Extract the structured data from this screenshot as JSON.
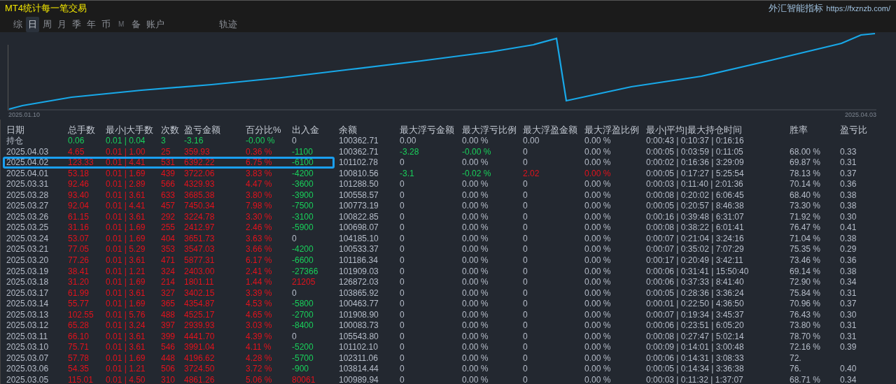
{
  "window": {
    "title": "MT4统计每一笔交易",
    "brand": "外汇智能指标",
    "url": "https://fxznzb.com/"
  },
  "tabs": [
    {
      "label": "综",
      "selected": false,
      "kind": "normal"
    },
    {
      "label": "日",
      "selected": true,
      "kind": "normal"
    },
    {
      "label": "周",
      "selected": false,
      "kind": "normal"
    },
    {
      "label": "月",
      "selected": false,
      "kind": "normal"
    },
    {
      "label": "季",
      "selected": false,
      "kind": "normal"
    },
    {
      "label": "年",
      "selected": false,
      "kind": "normal"
    },
    {
      "label": "币",
      "selected": false,
      "kind": "normal"
    },
    {
      "label": "M",
      "selected": false,
      "kind": "small"
    },
    {
      "label": "备",
      "selected": false,
      "kind": "normal"
    },
    {
      "label": "账户",
      "selected": false,
      "kind": "normal"
    },
    {
      "label": "轨迹",
      "selected": false,
      "kind": "far"
    }
  ],
  "chart": {
    "start_label": "2025.01.10",
    "end_label": "2025.04.03"
  },
  "table": {
    "columns": [
      "日期",
      "总手数",
      "最小|大手数",
      "次数",
      "盈亏金额",
      "百分比%",
      "出入金",
      "余额",
      "最大浮亏金额",
      "最大浮亏比例",
      "最大浮盈金额",
      "最大浮盈比例",
      "最小|平均|最大持仓时间",
      "胜率",
      "盈亏比"
    ],
    "rows": [
      {
        "selected": false,
        "cells": [
          "持仓",
          {
            "text": "0.06",
            "color": "#19cf5a"
          },
          {
            "text": "0.01 | 0.04",
            "color": "#19cf5a"
          },
          {
            "text": "3",
            "color": "#19cf5a"
          },
          {
            "text": "-3.16",
            "color": "#19cf5a"
          },
          {
            "text": "-0.00 %",
            "color": "#19cf5a"
          },
          "0",
          "100362.71",
          "0.00",
          "0.00 %",
          "0.00",
          "0.00 %",
          "0:00:43 | 0:10:37 | 0:16:16"
        ]
      },
      {
        "selected": false,
        "cells": [
          "2025.04.03",
          {
            "text": "4.65",
            "color": "#e3121c"
          },
          {
            "text": "0.01 | 1.00",
            "color": "#e3121c"
          },
          {
            "text": "25",
            "color": "#e3121c"
          },
          {
            "text": "359.93",
            "color": "#e3121c"
          },
          {
            "text": "0.36 %",
            "color": "#e3121c"
          },
          {
            "text": "-1100",
            "color": "#19cf5a"
          },
          "100362.71",
          {
            "text": "-3.28",
            "color": "#19cf5a"
          },
          {
            "text": "-0.00 %",
            "color": "#19cf5a"
          },
          "0",
          "0.00 %",
          "0:00:05 | 0:03:59 | 0:11:05",
          "68.00 %",
          "0.33"
        ]
      },
      {
        "selected": true,
        "cells": [
          "2025.04.02",
          {
            "text": "123.33",
            "color": "#e3121c"
          },
          {
            "text": "0.01 | 4.41",
            "color": "#e3121c"
          },
          {
            "text": "531",
            "color": "#e3121c"
          },
          {
            "text": "6392.22",
            "color": "#e3121c"
          },
          {
            "text": "6.75 %",
            "color": "#e3121c"
          },
          {
            "text": "-6100",
            "color": "#19cf5a"
          },
          "101102.78",
          "0",
          "0.00 %",
          "0",
          "0.00 %",
          "0:00:02 | 0:16:36 | 3:29:09",
          "69.87 %",
          "0.31"
        ]
      },
      {
        "selected": false,
        "cells": [
          "2025.04.01",
          {
            "text": "53.18",
            "color": "#e3121c"
          },
          {
            "text": "0.01 | 1.69",
            "color": "#e3121c"
          },
          {
            "text": "439",
            "color": "#e3121c"
          },
          {
            "text": "3722.06",
            "color": "#e3121c"
          },
          {
            "text": "3.83 %",
            "color": "#e3121c"
          },
          {
            "text": "-4200",
            "color": "#19cf5a"
          },
          "100810.56",
          {
            "text": "-3.1",
            "color": "#19cf5a"
          },
          {
            "text": "-0.02 %",
            "color": "#19cf5a"
          },
          {
            "text": "2.02",
            "color": "#e3121c"
          },
          {
            "text": "0.00 %",
            "color": "#e3121c"
          },
          "0:00:05 | 0:17:27 | 5:25:54",
          "78.13 %",
          "0.37"
        ]
      },
      {
        "selected": false,
        "cells": [
          "2025.03.31",
          {
            "text": "92.46",
            "color": "#e3121c"
          },
          {
            "text": "0.01 | 2.89",
            "color": "#e3121c"
          },
          {
            "text": "566",
            "color": "#e3121c"
          },
          {
            "text": "4329.93",
            "color": "#e3121c"
          },
          {
            "text": "4.47 %",
            "color": "#e3121c"
          },
          {
            "text": "-3600",
            "color": "#19cf5a"
          },
          "101288.50",
          "0",
          "0.00 %",
          "0",
          "0.00 %",
          "0:00:03 | 0:11:40 | 2:01:36",
          "70.14 %",
          "0.36"
        ]
      },
      {
        "selected": false,
        "cells": [
          "2025.03.28",
          {
            "text": "93.40",
            "color": "#e3121c"
          },
          {
            "text": "0.01 | 3.61",
            "color": "#e3121c"
          },
          {
            "text": "633",
            "color": "#e3121c"
          },
          {
            "text": "3685.38",
            "color": "#e3121c"
          },
          {
            "text": "3.80 %",
            "color": "#e3121c"
          },
          {
            "text": "-3900",
            "color": "#19cf5a"
          },
          "100558.57",
          "0",
          "0.00 %",
          "0",
          "0.00 %",
          "0:00:08 | 0:20:02 | 6:06:45",
          "68.40 %",
          "0.38"
        ]
      },
      {
        "selected": false,
        "cells": [
          "2025.03.27",
          {
            "text": "92.04",
            "color": "#e3121c"
          },
          {
            "text": "0.01 | 4.41",
            "color": "#e3121c"
          },
          {
            "text": "457",
            "color": "#e3121c"
          },
          {
            "text": "7450.34",
            "color": "#e3121c"
          },
          {
            "text": "7.98 %",
            "color": "#e3121c"
          },
          {
            "text": "-7500",
            "color": "#19cf5a"
          },
          "100773.19",
          "0",
          "0.00 %",
          "0",
          "0.00 %",
          "0:00:05 | 0:20:57 | 8:46:38",
          "73.30 %",
          "0.38"
        ]
      },
      {
        "selected": false,
        "cells": [
          "2025.03.26",
          {
            "text": "61.15",
            "color": "#e3121c"
          },
          {
            "text": "0.01 | 3.61",
            "color": "#e3121c"
          },
          {
            "text": "292",
            "color": "#e3121c"
          },
          {
            "text": "3224.78",
            "color": "#e3121c"
          },
          {
            "text": "3.30 %",
            "color": "#e3121c"
          },
          {
            "text": "-3100",
            "color": "#19cf5a"
          },
          "100822.85",
          "0",
          "0.00 %",
          "0",
          "0.00 %",
          "0:00:16 | 0:39:48 | 6:31:07",
          "71.92 %",
          "0.30"
        ]
      },
      {
        "selected": false,
        "cells": [
          "2025.03.25",
          {
            "text": "31.16",
            "color": "#e3121c"
          },
          {
            "text": "0.01 | 1.69",
            "color": "#e3121c"
          },
          {
            "text": "255",
            "color": "#e3121c"
          },
          {
            "text": "2412.97",
            "color": "#e3121c"
          },
          {
            "text": "2.46 %",
            "color": "#e3121c"
          },
          {
            "text": "-5900",
            "color": "#19cf5a"
          },
          "100698.07",
          "0",
          "0.00 %",
          "0",
          "0.00 %",
          "0:00:08 | 0:38:22 | 6:01:41",
          "76.47 %",
          "0.41"
        ]
      },
      {
        "selected": false,
        "cells": [
          "2025.03.24",
          {
            "text": "53.07",
            "color": "#e3121c"
          },
          {
            "text": "0.01 | 1.69",
            "color": "#e3121c"
          },
          {
            "text": "404",
            "color": "#e3121c"
          },
          {
            "text": "3651.73",
            "color": "#e3121c"
          },
          {
            "text": "3.63 %",
            "color": "#e3121c"
          },
          "0",
          "104185.10",
          "0",
          "0.00 %",
          "0",
          "0.00 %",
          "0:00:07 | 0:21:04 | 3:24:16",
          "71.04 %",
          "0.38"
        ]
      },
      {
        "selected": false,
        "cells": [
          "2025.03.21",
          {
            "text": "77.05",
            "color": "#e3121c"
          },
          {
            "text": "0.01 | 5.29",
            "color": "#e3121c"
          },
          {
            "text": "353",
            "color": "#e3121c"
          },
          {
            "text": "3547.03",
            "color": "#e3121c"
          },
          {
            "text": "3.66 %",
            "color": "#e3121c"
          },
          {
            "text": "-4200",
            "color": "#19cf5a"
          },
          "100533.37",
          "0",
          "0.00 %",
          "0",
          "0.00 %",
          "0:00:07 | 0:35:02 | 7:07:29",
          "75.35 %",
          "0.29"
        ]
      },
      {
        "selected": false,
        "cells": [
          "2025.03.20",
          {
            "text": "77.26",
            "color": "#e3121c"
          },
          {
            "text": "0.01 | 3.61",
            "color": "#e3121c"
          },
          {
            "text": "471",
            "color": "#e3121c"
          },
          {
            "text": "5877.31",
            "color": "#e3121c"
          },
          {
            "text": "6.17 %",
            "color": "#e3121c"
          },
          {
            "text": "-6600",
            "color": "#19cf5a"
          },
          "101186.34",
          "0",
          "0.00 %",
          "0",
          "0.00 %",
          "0:00:17 | 0:20:49 | 3:42:11",
          "73.46 %",
          "0.36"
        ]
      },
      {
        "selected": false,
        "cells": [
          "2025.03.19",
          {
            "text": "38.41",
            "color": "#e3121c"
          },
          {
            "text": "0.01 | 1.21",
            "color": "#e3121c"
          },
          {
            "text": "324",
            "color": "#e3121c"
          },
          {
            "text": "2403.00",
            "color": "#e3121c"
          },
          {
            "text": "2.41 %",
            "color": "#e3121c"
          },
          {
            "text": "-27366",
            "color": "#19cf5a"
          },
          "101909.03",
          "0",
          "0.00 %",
          "0",
          "0.00 %",
          "0:00:06 | 0:31:41 | 15:50:40",
          "69.14 %",
          "0.38"
        ]
      },
      {
        "selected": false,
        "cells": [
          "2025.03.18",
          {
            "text": "31.20",
            "color": "#e3121c"
          },
          {
            "text": "0.01 | 1.69",
            "color": "#e3121c"
          },
          {
            "text": "214",
            "color": "#e3121c"
          },
          {
            "text": "1801.11",
            "color": "#e3121c"
          },
          {
            "text": "1.44 %",
            "color": "#e3121c"
          },
          {
            "text": "21205",
            "color": "#e3121c"
          },
          "126872.03",
          "0",
          "0.00 %",
          "0",
          "0.00 %",
          "0:00:06 | 0:37:33 | 8:41:40",
          "72.90 %",
          "0.34"
        ]
      },
      {
        "selected": false,
        "cells": [
          "2025.03.17",
          {
            "text": "61.99",
            "color": "#e3121c"
          },
          {
            "text": "0.01 | 3.61",
            "color": "#e3121c"
          },
          {
            "text": "327",
            "color": "#e3121c"
          },
          {
            "text": "3402.15",
            "color": "#e3121c"
          },
          {
            "text": "3.39 %",
            "color": "#e3121c"
          },
          "0",
          "103865.92",
          "0",
          "0.00 %",
          "0",
          "0.00 %",
          "0:00:05 | 0:28:36 | 3:36:24",
          "75.84 %",
          "0.31"
        ]
      },
      {
        "selected": false,
        "cells": [
          "2025.03.14",
          {
            "text": "55.77",
            "color": "#e3121c"
          },
          {
            "text": "0.01 | 1.69",
            "color": "#e3121c"
          },
          {
            "text": "365",
            "color": "#e3121c"
          },
          {
            "text": "4354.87",
            "color": "#e3121c"
          },
          {
            "text": "4.53 %",
            "color": "#e3121c"
          },
          {
            "text": "-5800",
            "color": "#19cf5a"
          },
          "100463.77",
          "0",
          "0.00 %",
          "0",
          "0.00 %",
          "0:00:01 | 0:22:50 | 4:36:50",
          "70.96 %",
          "0.37"
        ]
      },
      {
        "selected": false,
        "cells": [
          "2025.03.13",
          {
            "text": "102.55",
            "color": "#e3121c"
          },
          {
            "text": "0.01 | 5.76",
            "color": "#e3121c"
          },
          {
            "text": "488",
            "color": "#e3121c"
          },
          {
            "text": "4525.17",
            "color": "#e3121c"
          },
          {
            "text": "4.65 %",
            "color": "#e3121c"
          },
          {
            "text": "-2700",
            "color": "#19cf5a"
          },
          "101908.90",
          "0",
          "0.00 %",
          "0",
          "0.00 %",
          "0:00:07 | 0:19:34 | 3:45:37",
          "76.43 %",
          "0.30"
        ]
      },
      {
        "selected": false,
        "cells": [
          "2025.03.12",
          {
            "text": "65.28",
            "color": "#e3121c"
          },
          {
            "text": "0.01 | 3.24",
            "color": "#e3121c"
          },
          {
            "text": "397",
            "color": "#e3121c"
          },
          {
            "text": "2939.93",
            "color": "#e3121c"
          },
          {
            "text": "3.03 %",
            "color": "#e3121c"
          },
          {
            "text": "-8400",
            "color": "#19cf5a"
          },
          "100083.73",
          "0",
          "0.00 %",
          "0",
          "0.00 %",
          "0:00:06 | 0:23:51 | 6:05:20",
          "73.80 %",
          "0.31"
        ]
      },
      {
        "selected": false,
        "cells": [
          "2025.03.11",
          {
            "text": "66.10",
            "color": "#e3121c"
          },
          {
            "text": "0.01 | 3.61",
            "color": "#e3121c"
          },
          {
            "text": "399",
            "color": "#e3121c"
          },
          {
            "text": "4441.70",
            "color": "#e3121c"
          },
          {
            "text": "4.39 %",
            "color": "#e3121c"
          },
          "0",
          "105543.80",
          "0",
          "0.00 %",
          "0",
          "0.00 %",
          "0:00:08 | 0:27:47 | 5:02:14",
          "78.70 %",
          "0.31"
        ]
      },
      {
        "selected": false,
        "cells": [
          "2025.03.10",
          {
            "text": "75.71",
            "color": "#e3121c"
          },
          {
            "text": "0.01 | 3.61",
            "color": "#e3121c"
          },
          {
            "text": "546",
            "color": "#e3121c"
          },
          {
            "text": "3991.04",
            "color": "#e3121c"
          },
          {
            "text": "4.11 %",
            "color": "#e3121c"
          },
          {
            "text": "-5200",
            "color": "#19cf5a"
          },
          "101102.10",
          "0",
          "0.00 %",
          "0",
          "0.00 %",
          "0:00:09 | 0:14:01 | 3:00:48",
          "72.16 %",
          "0.39"
        ]
      },
      {
        "selected": false,
        "cells": [
          "2025.03.07",
          {
            "text": "57.78",
            "color": "#e3121c"
          },
          {
            "text": "0.01 | 1.69",
            "color": "#e3121c"
          },
          {
            "text": "448",
            "color": "#e3121c"
          },
          {
            "text": "4196.62",
            "color": "#e3121c"
          },
          {
            "text": "4.28 %",
            "color": "#e3121c"
          },
          {
            "text": "-5700",
            "color": "#19cf5a"
          },
          "102311.06",
          "0",
          "0.00 %",
          "0",
          "0.00 %",
          "0:00:06 | 0:14:31 | 3:08:33",
          "72."
        ]
      },
      {
        "selected": false,
        "cells": [
          "2025.03.06",
          {
            "text": "54.35",
            "color": "#e3121c"
          },
          {
            "text": "0.01 | 1.21",
            "color": "#e3121c"
          },
          {
            "text": "506",
            "color": "#e3121c"
          },
          {
            "text": "3724.50",
            "color": "#e3121c"
          },
          {
            "text": "3.72 %",
            "color": "#e3121c"
          },
          {
            "text": "-900",
            "color": "#19cf5a"
          },
          "103814.44",
          "0",
          "0.00 %",
          "0",
          "0.00 %",
          "0:00:05 | 0:14:34 | 3:36:38",
          "76.",
          "0.40"
        ]
      },
      {
        "selected": false,
        "cells": [
          "2025.03.05",
          {
            "text": "115.01",
            "color": "#e3121c"
          },
          {
            "text": "0.01 | 4.50",
            "color": "#e3121c"
          },
          {
            "text": "310",
            "color": "#e3121c"
          },
          {
            "text": "4861.26",
            "color": "#e3121c"
          },
          {
            "text": "5.06 %",
            "color": "#e3121c"
          },
          {
            "text": "80061",
            "color": "#e3121c"
          },
          "100989.94",
          "0",
          "0.00 %",
          "0",
          "0.00 %",
          "0:00:03 | 0:11:32 | 1:37:07",
          "68.71 %",
          "0.34"
        ]
      }
    ]
  }
}
